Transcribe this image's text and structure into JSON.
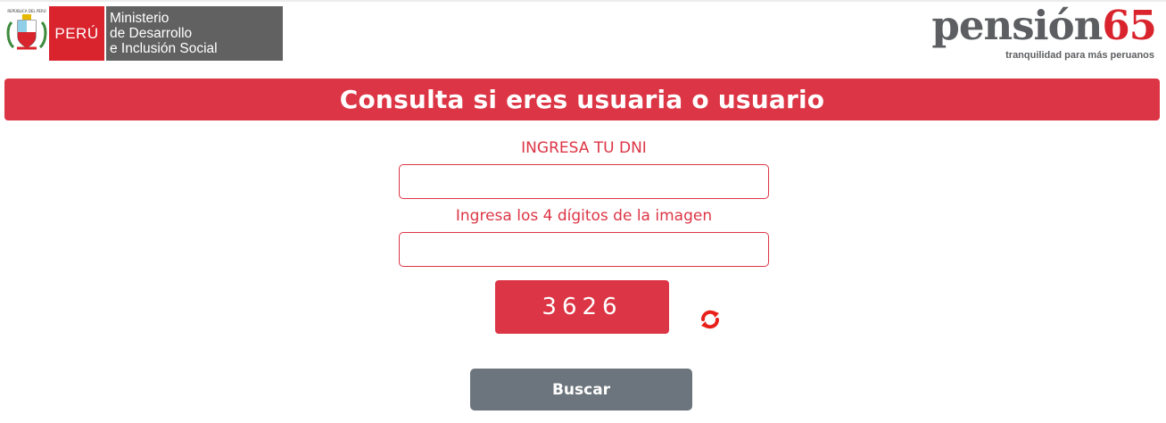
{
  "header": {
    "country_label": "PERÚ",
    "ministry_lines": [
      "Ministerio",
      "de Desarrollo",
      "e Inclusión Social"
    ],
    "program_word": "pensión",
    "program_number": "65",
    "program_tagline": "tranquilidad para más peruanos"
  },
  "banner": {
    "title": "Consulta si eres usuaria o usuario"
  },
  "form": {
    "dni_label": "INGRESA TU DNI",
    "dni_value": "",
    "captcha_label": "Ingresa los 4 dígitos de la imagen",
    "captcha_value": "",
    "captcha_code": "3626",
    "submit_label": "Buscar"
  },
  "colors": {
    "accent": "#dc3545",
    "brand_red": "#d9232d",
    "brand_gray": "#616161",
    "button_gray": "#6c757d"
  },
  "icons": {
    "refresh": "refresh-icon",
    "coat_of_arms": "coat-of-arms-icon"
  }
}
